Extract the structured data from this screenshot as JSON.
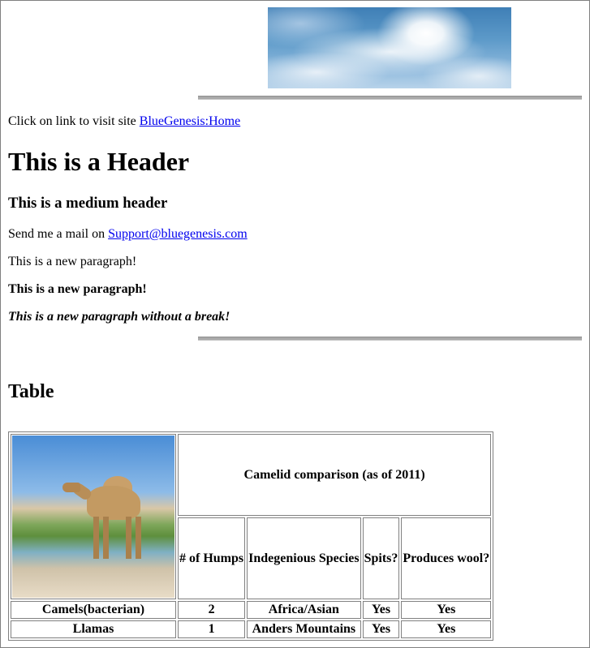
{
  "banner": {
    "icon": "sky-clouds-image"
  },
  "link_line": {
    "prefix": "Click on link to visit site ",
    "link_text": "BlueGenesis:Home"
  },
  "header1": "This is a Header",
  "header3": "This is a medium header",
  "mail_line": {
    "prefix": "Send me a mail on ",
    "link_text": "Support@bluegenesis.com"
  },
  "para1": "This is a new paragraph!",
  "para2": "This is a new paragraph!",
  "para3": "This is a new paragraph without a break!",
  "header2": "Table",
  "table": {
    "image": "camel-photo",
    "caption": "Camelid comparison (as of 2011)",
    "columns": [
      "# of Humps",
      "Indegenious Species",
      "Spits?",
      "Produces wool?"
    ],
    "rows": [
      [
        "Camels(bacterian)",
        "2",
        "Africa/Asian",
        "Yes",
        "Yes"
      ],
      [
        "Llamas",
        "1",
        "Anders Mountains",
        "Yes",
        "Yes"
      ]
    ]
  },
  "colors": {
    "link": "#0000ee",
    "rule": "#a9a9a9",
    "border": "#808080"
  }
}
